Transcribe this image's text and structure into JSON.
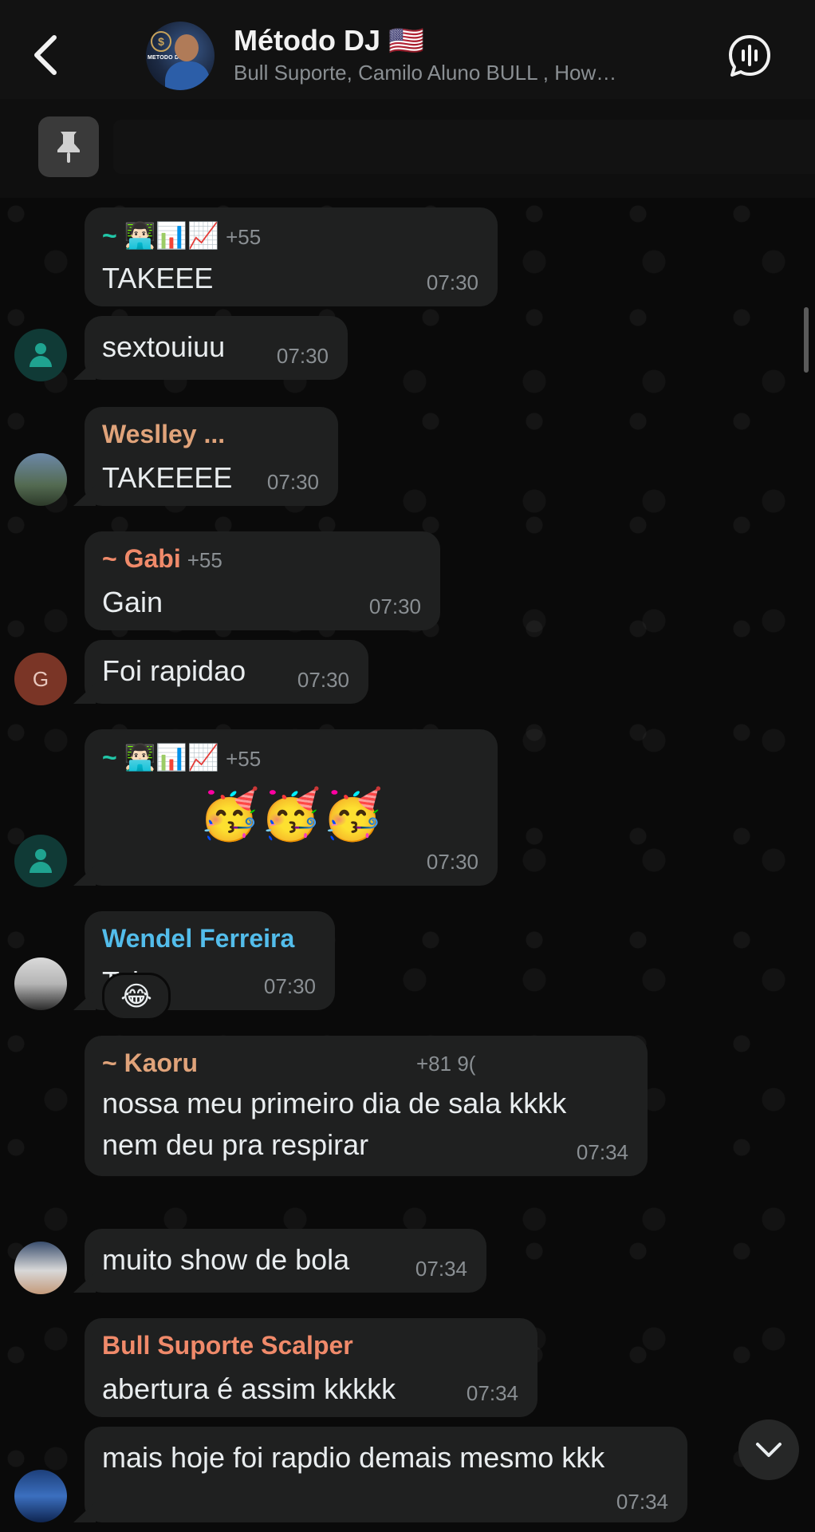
{
  "header": {
    "title": "Método DJ 🇺🇸",
    "subtitle": "Bull Suporte, Camilo Aluno BULL , How…",
    "avatar_badge": "METODO DJ",
    "avatar_coin": "$"
  },
  "messages": [
    {
      "sender": "~ 👨🏻‍💻📊📈",
      "phone": "+55",
      "text": "TAKEEE",
      "time": "07:30",
      "sender_color": "#21c7a8"
    },
    {
      "text": "sextouiuu",
      "time": "07:30"
    },
    {
      "sender": "Weslley ...",
      "text": "TAKEEEE",
      "time": "07:30",
      "sender_color": "#e0a37a"
    },
    {
      "sender": "~ Gabi",
      "phone": "+55",
      "text": "Gain",
      "time": "07:30",
      "sender_color": "#f08a6a"
    },
    {
      "text": "Foi rapidao",
      "time": "07:30",
      "avatar_initial": "G"
    },
    {
      "sender": "~ 👨🏻‍💻📊📈",
      "phone": "+55",
      "text": "🥳🥳🥳",
      "time": "07:30",
      "sender_color": "#21c7a8"
    },
    {
      "sender": "Wendel Ferreira",
      "text": "Take",
      "time": "07:30",
      "sender_color": "#53bdeb"
    },
    {
      "sender": "~ Kaoru",
      "phone": "+81 9(",
      "text_line1": "nossa meu primeiro dia de sala kkkk",
      "text_line2": "nem deu pra respirar",
      "time": "07:34",
      "sender_color": "#e0a37a",
      "reaction": "😂"
    },
    {
      "text": "muito show de bola",
      "time": "07:34"
    },
    {
      "sender": "Bull Suporte Scalper",
      "text": "abertura é assim kkkkk",
      "time": "07:34",
      "sender_color": "#f08a6a"
    },
    {
      "text": "mais hoje foi rapdio demais mesmo kkk",
      "time": "07:34"
    }
  ]
}
